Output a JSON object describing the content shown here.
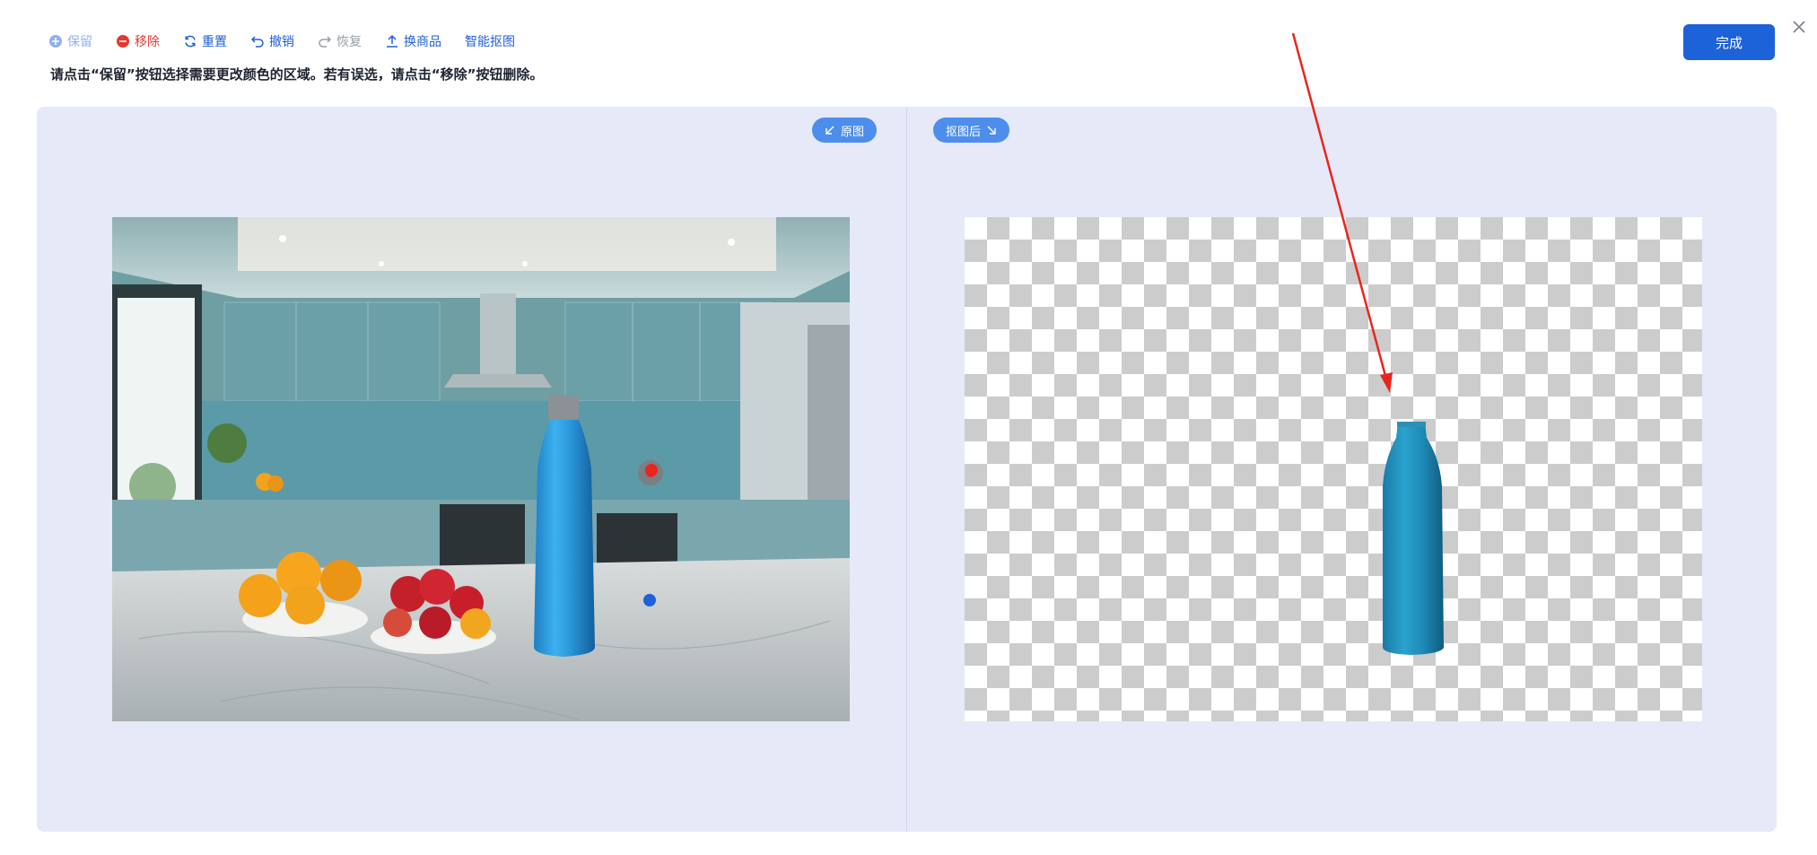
{
  "toolbar": {
    "keep": "保留",
    "remove": "移除",
    "reset": "重置",
    "undo": "撤销",
    "redo": "恢复",
    "replace_product": "换商品",
    "smart_cutout": "智能抠图"
  },
  "hint": "请点击“保留”按钮选择需要更改颜色的区域。若有误选，请点击“移除”按钮删除。",
  "done_label": "完成",
  "panels": {
    "original_label": "原图",
    "cutout_label": "抠图后"
  },
  "colors": {
    "accent": "#1c62d8",
    "pill": "#4d8eec",
    "remove": "#e8372d",
    "workspace_bg": "#e6e9f7",
    "annotation_arrow": "#e8261e"
  },
  "icons": {
    "keep": "plus-circle-icon",
    "remove": "minus-circle-icon",
    "reset": "refresh-icon",
    "undo": "undo-icon",
    "redo": "redo-icon",
    "replace_product": "upload-icon",
    "close": "close-icon"
  }
}
